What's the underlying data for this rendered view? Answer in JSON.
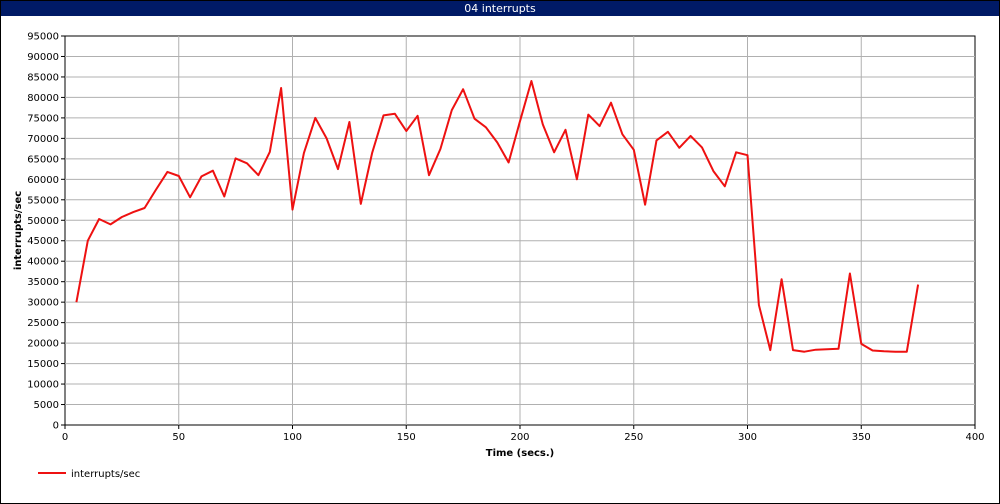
{
  "window": {
    "title": "04 interrupts"
  },
  "colors": {
    "title_bar": "#001a66",
    "series": "#ee1111",
    "grid": "#b0b0b0"
  },
  "chart_data": {
    "type": "line",
    "title": "04 interrupts",
    "xlabel": "Time (secs.)",
    "ylabel": "interrupts/sec",
    "xlim": [
      0,
      400
    ],
    "ylim": [
      0,
      95000
    ],
    "x_ticks": [
      0,
      50,
      100,
      150,
      200,
      250,
      300,
      350,
      400
    ],
    "y_ticks": [
      0,
      5000,
      10000,
      15000,
      20000,
      25000,
      30000,
      35000,
      40000,
      45000,
      50000,
      55000,
      60000,
      65000,
      70000,
      75000,
      80000,
      85000,
      90000,
      95000
    ],
    "grid": true,
    "legend_position": "bottom-left",
    "series": [
      {
        "name": "interrupts/sec",
        "x": [
          5,
          10,
          15,
          20,
          25,
          30,
          35,
          40,
          45,
          50,
          55,
          60,
          65,
          70,
          75,
          80,
          85,
          90,
          95,
          100,
          105,
          110,
          115,
          120,
          125,
          130,
          135,
          140,
          145,
          150,
          155,
          160,
          165,
          170,
          175,
          180,
          185,
          190,
          195,
          200,
          205,
          210,
          215,
          220,
          225,
          230,
          235,
          240,
          245,
          250,
          255,
          260,
          265,
          270,
          275,
          280,
          285,
          290,
          295,
          300,
          305,
          310,
          315,
          320,
          325,
          330,
          335,
          340,
          345,
          350,
          355,
          360,
          365,
          370,
          375
        ],
        "y": [
          30000,
          45000,
          50300,
          49000,
          50800,
          52000,
          53000,
          57500,
          61800,
          60800,
          55600,
          60700,
          62100,
          55800,
          65100,
          63900,
          61000,
          66700,
          82300,
          52600,
          66400,
          75000,
          70000,
          62500,
          74000,
          54000,
          66400,
          75600,
          76000,
          71800,
          75500,
          61000,
          67400,
          76900,
          82000,
          74800,
          72700,
          69000,
          64100,
          74200,
          84000,
          73400,
          66600,
          72100,
          60000,
          75800,
          73000,
          78700,
          71000,
          67200,
          53800,
          69500,
          71600,
          67700,
          70600,
          67800,
          62000,
          58300,
          66600,
          65900,
          29300,
          18300,
          35600,
          18300,
          17900,
          18400,
          18500,
          18600,
          37000,
          19800,
          18200,
          18000,
          17900,
          17900,
          34300
        ]
      }
    ]
  }
}
